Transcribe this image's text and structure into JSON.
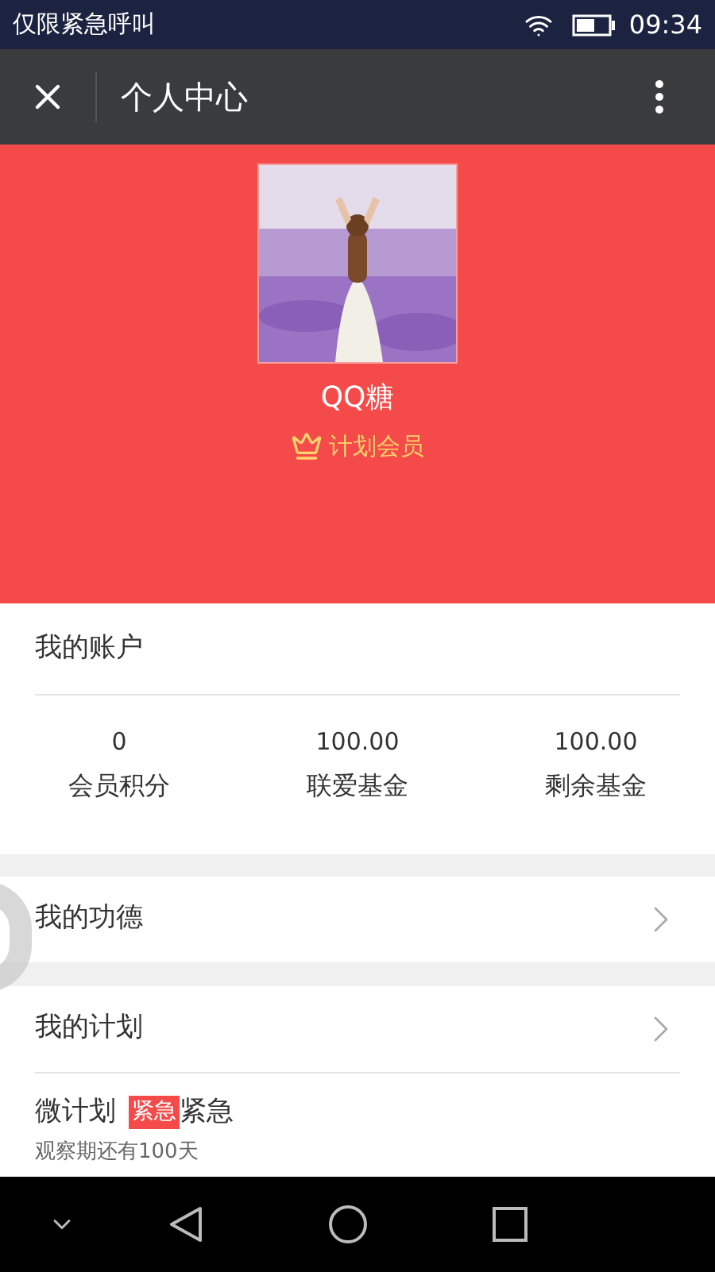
{
  "status_bar": {
    "carrier": "仅限紧急呼叫",
    "time": "09:34"
  },
  "toolbar": {
    "title": "个人中心"
  },
  "profile": {
    "name": "QQ糖",
    "membership": "计划会员"
  },
  "account": {
    "title": "我的账户",
    "stats": [
      {
        "value": "0",
        "label": "会员积分"
      },
      {
        "value": "100.00",
        "label": "联爱基金"
      },
      {
        "value": "100.00",
        "label": "剩余基金"
      }
    ]
  },
  "menu": [
    {
      "label": "我的功德"
    },
    {
      "label": "我的计划"
    }
  ],
  "plans": [
    {
      "title": "微计划",
      "tag": "紧急",
      "tag_text": "紧急",
      "subtitle": "观察期还有100天"
    }
  ]
}
